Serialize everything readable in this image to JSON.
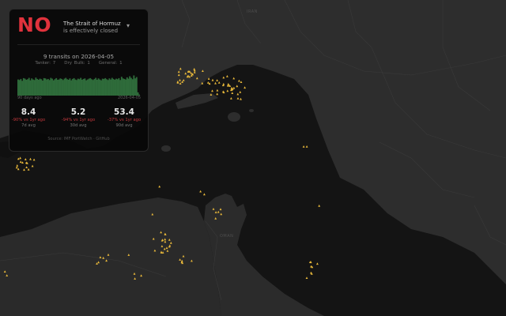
{
  "status": {
    "answer": "NO",
    "headline_line1": "The Strait of Hormuz",
    "headline_line2": "is effectively closed",
    "color": "#e0323c"
  },
  "summary": {
    "transits_text": "9 transits on 2026-04-05",
    "breakdown": {
      "tanker": "Tanker: 7",
      "dry_bulk": "Dry Bulk: 1",
      "general": "General: 1"
    }
  },
  "chart_data": {
    "type": "bar",
    "x_start_label": "90 days ago",
    "x_end_label": "2026-04-05",
    "bar_color": "#2e6b3a",
    "values": [
      60,
      58,
      62,
      55,
      65,
      63,
      59,
      61,
      66,
      57,
      64,
      60,
      58,
      67,
      62,
      59,
      63,
      61,
      56,
      65,
      64,
      60,
      62,
      58,
      66,
      63,
      57,
      61,
      65,
      59,
      60,
      64,
      62,
      58,
      63,
      66,
      61,
      59,
      64,
      57,
      62,
      65,
      60,
      58,
      63,
      61,
      66,
      59,
      62,
      64,
      57,
      60,
      63,
      65,
      61,
      58,
      62,
      66,
      59,
      64,
      60,
      57,
      63,
      62,
      65,
      61,
      58,
      64,
      60,
      66,
      62,
      59,
      63,
      61,
      65,
      58,
      70,
      64,
      62,
      60,
      68,
      63,
      72,
      66,
      61,
      75,
      64,
      69,
      12,
      4
    ]
  },
  "stats": [
    {
      "value": "8.4",
      "delta": "-90% vs 1yr ago",
      "label": "7d avg"
    },
    {
      "value": "5.2",
      "delta": "-94% vs 1yr ago",
      "label": "30d avg"
    },
    {
      "value": "53.4",
      "delta": "-37% vs 1yr ago",
      "label": "90d avg"
    }
  ],
  "source": "Source: IMF PortWatch · GitHub",
  "map": {
    "country_label": "IRAN",
    "oman_label": "OMAN",
    "ship_color": "#e8b83a"
  }
}
